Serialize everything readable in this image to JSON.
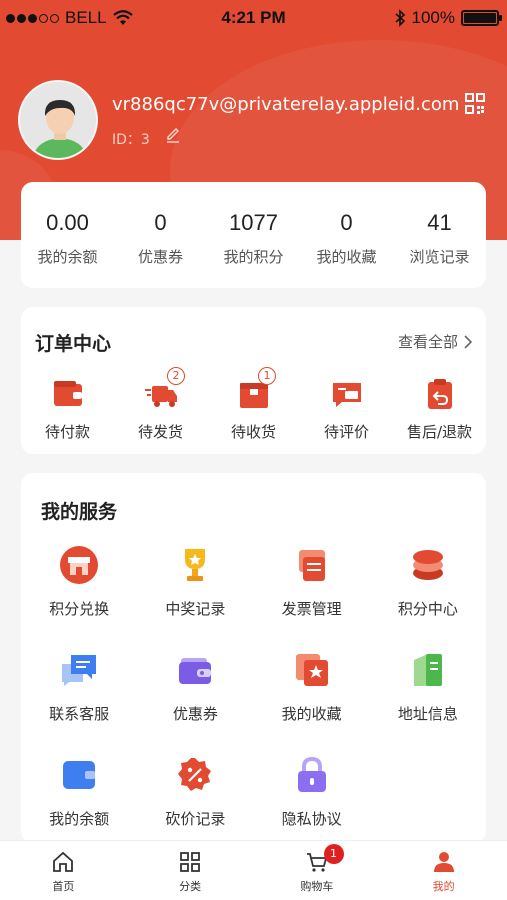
{
  "status_bar": {
    "carrier": "BELL",
    "time": "4:21 PM",
    "battery": "100%",
    "battery_level": 1.0
  },
  "profile": {
    "email": "vr886qc77v@privaterelay.appleid.com",
    "id_text": "ID：3"
  },
  "stats": [
    {
      "value": "0.00",
      "label": "我的余额"
    },
    {
      "value": "0",
      "label": "优惠券"
    },
    {
      "value": "1077",
      "label": "我的积分"
    },
    {
      "value": "0",
      "label": "我的收藏"
    },
    {
      "value": "41",
      "label": "浏览记录"
    }
  ],
  "orders": {
    "title": "订单中心",
    "view_all": "查看全部",
    "items": [
      {
        "label": "待付款",
        "badge": ""
      },
      {
        "label": "待发货",
        "badge": "2"
      },
      {
        "label": "待收货",
        "badge": "1"
      },
      {
        "label": "待评价",
        "badge": ""
      },
      {
        "label": "售后/退款",
        "badge": ""
      }
    ]
  },
  "services": {
    "title": "我的服务",
    "items": [
      {
        "label": "积分兑换",
        "icon": "shop-icon"
      },
      {
        "label": "中奖记录",
        "icon": "trophy-icon"
      },
      {
        "label": "发票管理",
        "icon": "invoice-icon"
      },
      {
        "label": "积分中心",
        "icon": "coins-icon"
      },
      {
        "label": "联系客服",
        "icon": "chat-icon"
      },
      {
        "label": "优惠券",
        "icon": "wallet-icon"
      },
      {
        "label": "我的收藏",
        "icon": "star-icon"
      },
      {
        "label": "地址信息",
        "icon": "book-icon"
      },
      {
        "label": "我的余额",
        "icon": "card-icon"
      },
      {
        "label": "砍价记录",
        "icon": "discount-icon"
      },
      {
        "label": "隐私协议",
        "icon": "lock-icon"
      }
    ]
  },
  "tabbar": {
    "items": [
      {
        "label": "首页",
        "icon": "home-icon"
      },
      {
        "label": "分类",
        "icon": "grid-icon"
      },
      {
        "label": "购物车",
        "icon": "cart-icon",
        "badge": "1"
      },
      {
        "label": "我的",
        "icon": "user-icon"
      }
    ]
  },
  "colors": {
    "accent": "#e24a32",
    "background": "#f5f5f5",
    "card": "#ffffff"
  }
}
